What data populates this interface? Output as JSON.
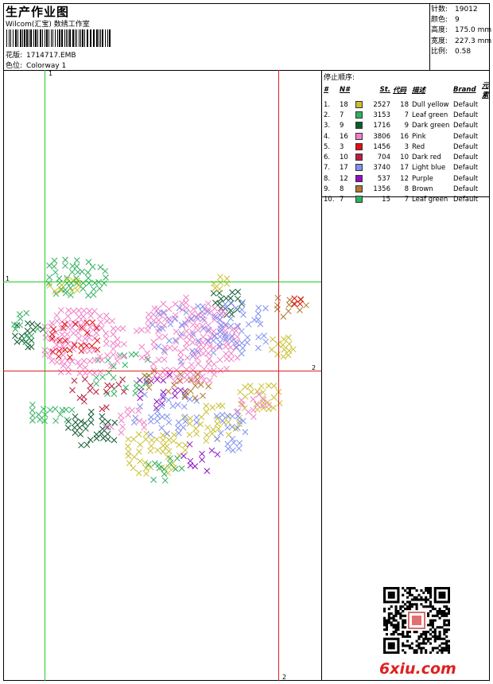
{
  "header": {
    "title": "生产作业图",
    "company": "Wilcom(汇宝) 数绣工作室",
    "pattern_label": "花版:",
    "pattern_value": "1714717.EMB",
    "colorway_label": "色位:",
    "colorway_value": "Colorway 1"
  },
  "stats": {
    "stitches_label": "针数:",
    "stitches_value": "19012",
    "colors_label": "颜色:",
    "colors_value": "9",
    "height_label": "高度:",
    "height_value": "175.0 mm",
    "width_label": "宽度:",
    "width_value": "227.3 mm",
    "scale_label": "比例:",
    "scale_value": "0.58"
  },
  "stop_sequence": {
    "title": "停止顺序:",
    "headers": [
      "#",
      "N#",
      "St.",
      "代码",
      "描述",
      "Brand",
      "元素"
    ],
    "rows": [
      {
        "idx": "1.",
        "n": "18",
        "color": "#c8c030",
        "st": "2527",
        "code": "18",
        "desc": "Dull yellow",
        "brand": "Default"
      },
      {
        "idx": "2.",
        "n": "7",
        "color": "#30b060",
        "st": "3153",
        "code": "7",
        "desc": "Leaf green",
        "brand": "Default"
      },
      {
        "idx": "3.",
        "n": "9",
        "color": "#0f5a30",
        "st": "1716",
        "code": "9",
        "desc": "Dark green",
        "brand": "Default"
      },
      {
        "idx": "4.",
        "n": "16",
        "color": "#f080c8",
        "st": "3806",
        "code": "16",
        "desc": "Pink",
        "brand": "Default"
      },
      {
        "idx": "5.",
        "n": "3",
        "color": "#e01010",
        "st": "1456",
        "code": "3",
        "desc": "Red",
        "brand": "Default"
      },
      {
        "idx": "6.",
        "n": "10",
        "color": "#b82040",
        "st": "704",
        "code": "10",
        "desc": "Dark red",
        "brand": "Default"
      },
      {
        "idx": "7.",
        "n": "17",
        "color": "#8090f0",
        "st": "3740",
        "code": "17",
        "desc": "Light blue",
        "brand": "Default"
      },
      {
        "idx": "8.",
        "n": "12",
        "color": "#9010c0",
        "st": "537",
        "code": "12",
        "desc": "Purple",
        "brand": "Default"
      },
      {
        "idx": "9.",
        "n": "8",
        "color": "#b07830",
        "st": "1356",
        "code": "8",
        "desc": "Brown",
        "brand": "Default"
      },
      {
        "idx": "10.",
        "n": "7",
        "color": "#30b060",
        "st": "15",
        "code": "7",
        "desc": "Leaf green",
        "brand": "Default"
      }
    ]
  },
  "guides": {
    "green_v_label": "1",
    "green_h_label": "1",
    "red_h_label": "2",
    "red_v_label": "2"
  },
  "footer": {
    "logo_text": "6xiu.com"
  }
}
